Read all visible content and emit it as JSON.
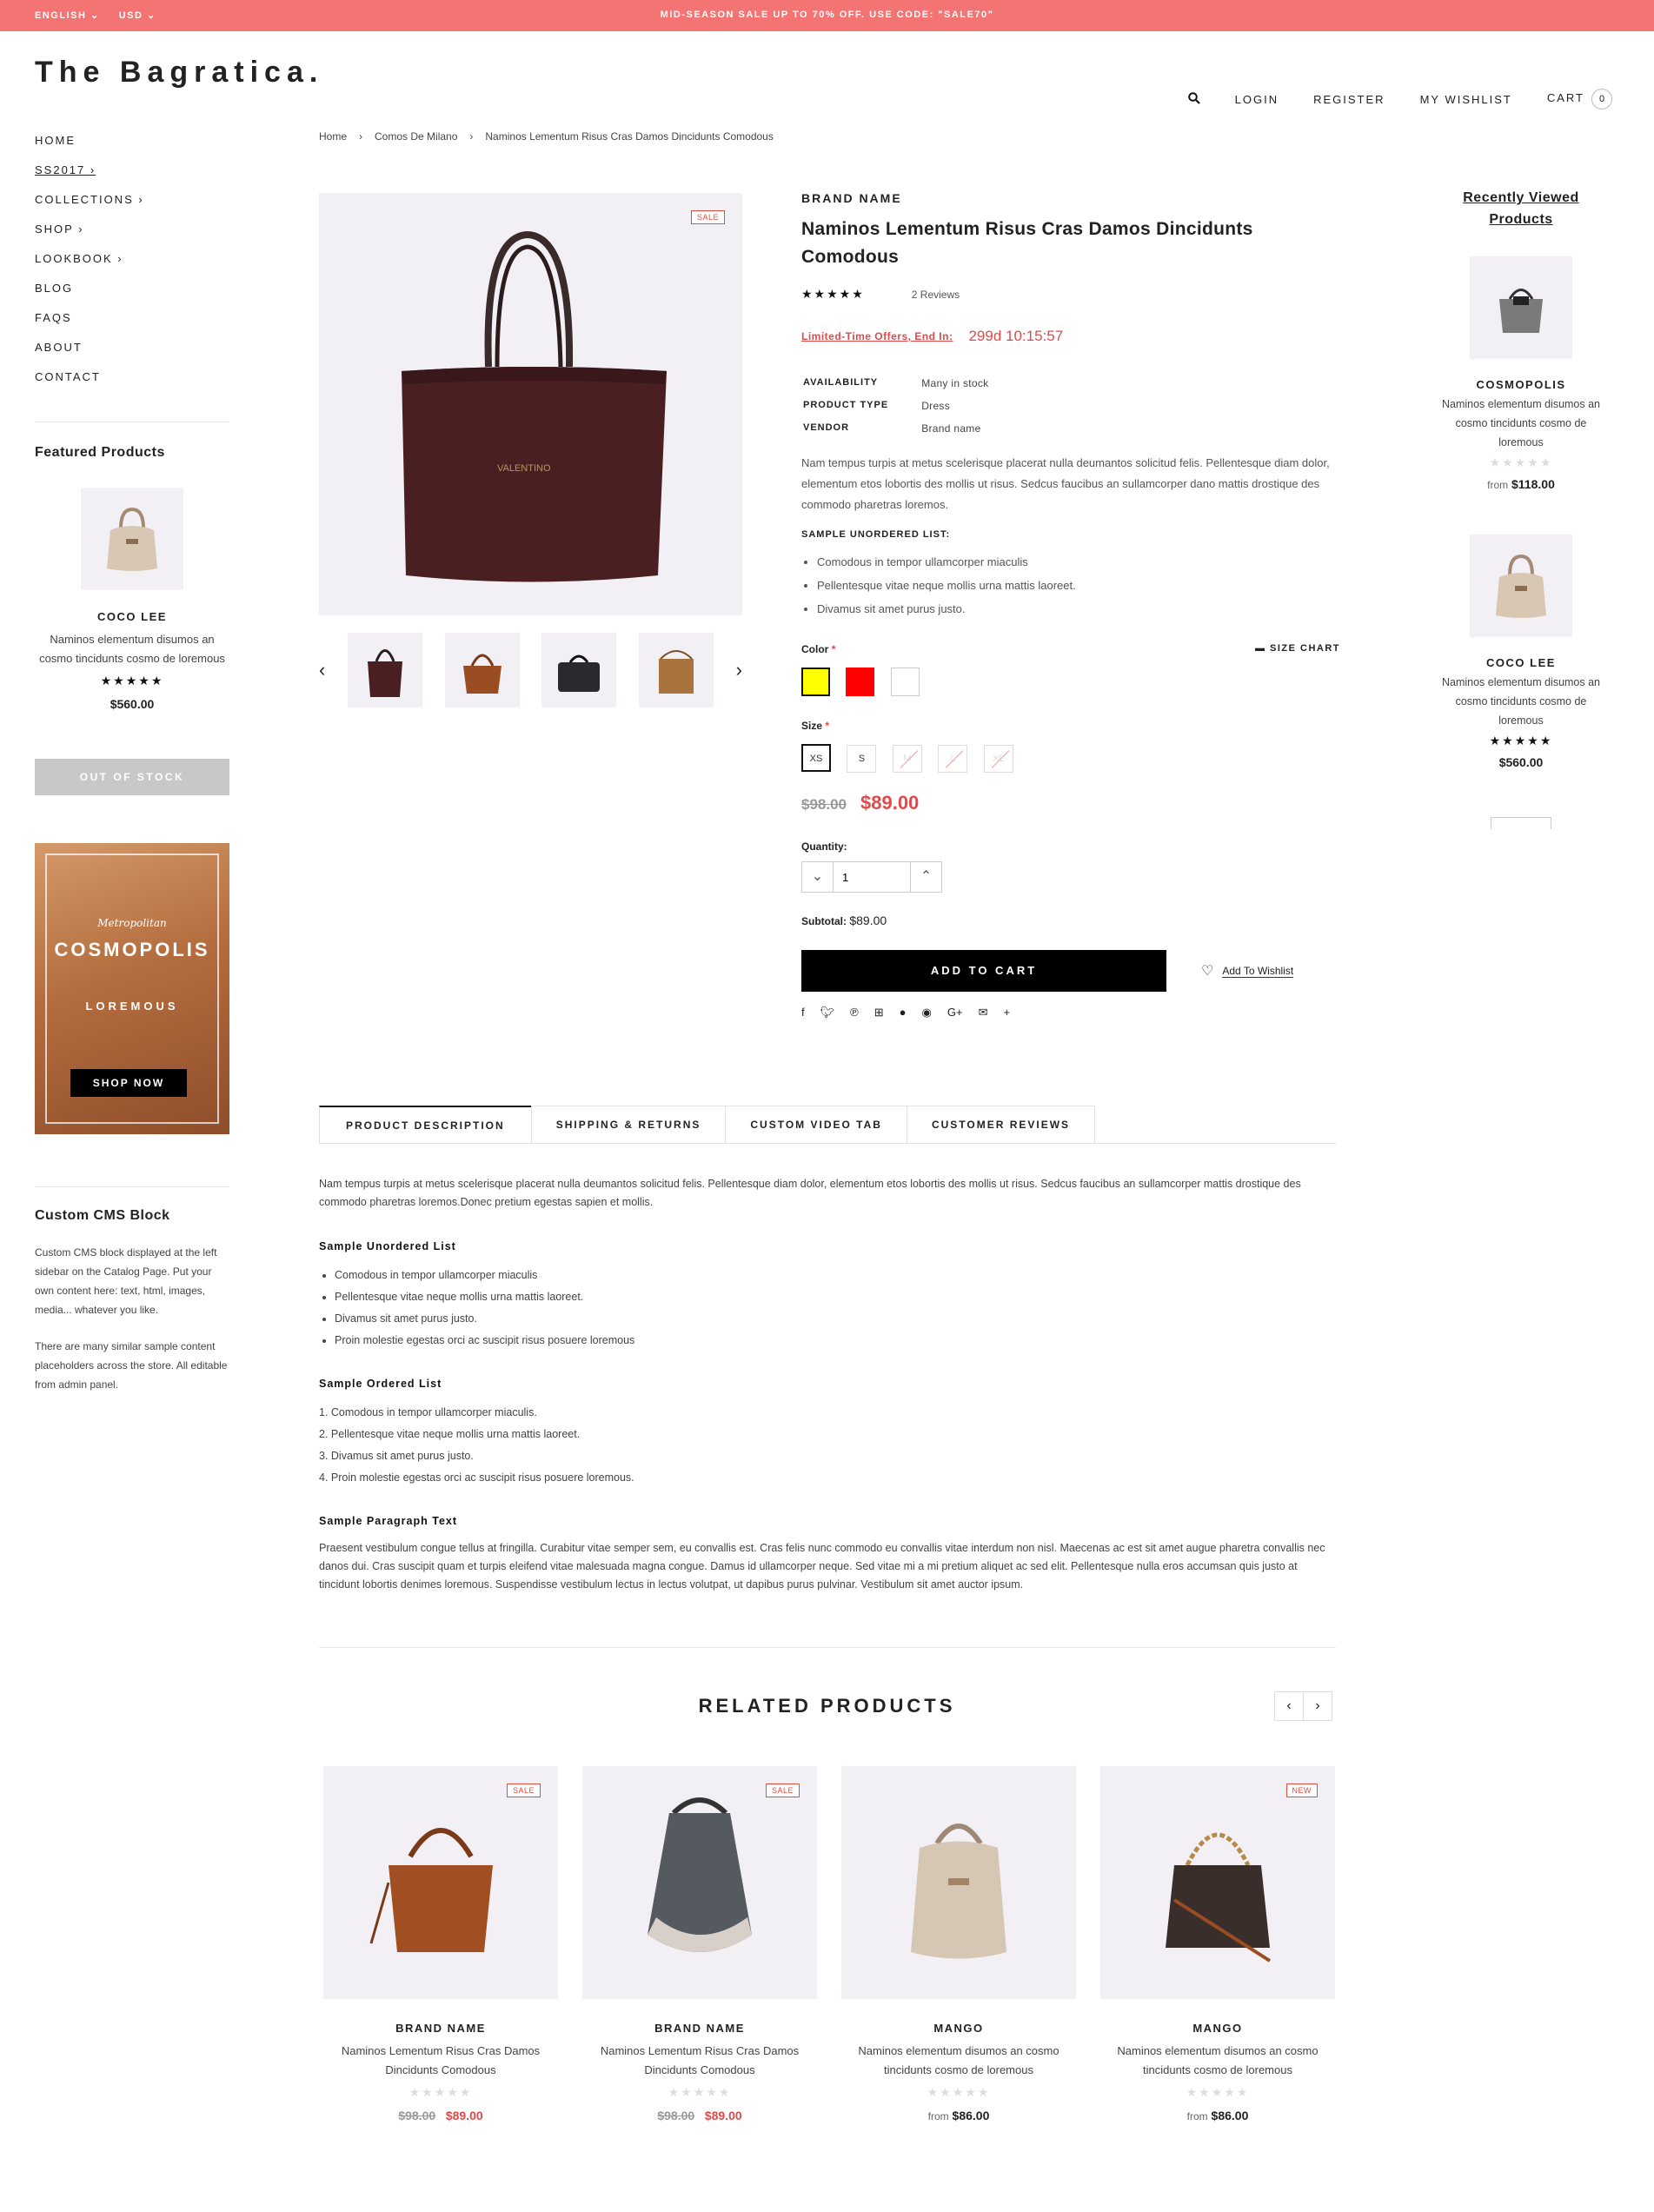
{
  "topbar": {
    "language": "ENGLISH",
    "currency": "USD",
    "promo": "MID-SEASON SALE UP TO 70% OFF. USE CODE: \"SALE70\""
  },
  "header": {
    "logo": "The Bagratica.",
    "login": "LOGIN",
    "register": "REGISTER",
    "wishlist": "MY WISHLIST",
    "cart": "CART",
    "cart_count": "0"
  },
  "sidebar": {
    "nav": [
      "HOME",
      "SS2017 ›",
      "COLLECTIONS ›",
      "SHOP ›",
      "LOOKBOOK ›",
      "BLOG",
      "FAQS",
      "ABOUT",
      "CONTACT"
    ],
    "featured_title": "Featured Products",
    "featured": {
      "brand": "COCO LEE",
      "name": "Naminos elementum disumos an cosmo tincidunts cosmo de loremous",
      "price": "$560.00",
      "button": "OUT OF STOCK"
    },
    "promo": {
      "script": "Metropolitan",
      "title": "COSMOPOLIS",
      "subtitle": "LOREMOUS",
      "button": "SHOP NOW"
    },
    "cms_title": "Custom CMS Block",
    "cms_p1": "Custom CMS block displayed at the left sidebar on the Catalog Page. Put your own content here: text, html, images, media... whatever you like.",
    "cms_p2": "There are many similar sample content placeholders across the store. All editable from admin panel."
  },
  "breadcrumb": {
    "home": "Home",
    "sep": "›",
    "collection": "Comos De Milano",
    "current": "Naminos Lementum Risus Cras Damos Dincidunts Comodous"
  },
  "product": {
    "badge": "SALE",
    "brand": "BRAND NAME",
    "title": "Naminos Lementum Risus Cras Damos Dincidunts Comodous",
    "reviews": "2 Reviews",
    "countdown_label": "Limited-Time Offers, End In:",
    "countdown": "299d 10:15:57",
    "availability_label": "AVAILABILITY",
    "availability": "Many in stock",
    "type_label": "PRODUCT TYPE",
    "type": "Dress",
    "vendor_label": "VENDOR",
    "vendor": "Brand name",
    "description": "Nam tempus turpis at metus scelerisque placerat nulla deumantos solicitud felis. Pellentesque diam dolor, elementum etos lobortis des mollis ut risus. Sedcus faucibus an sullamcorper dano mattis drostique des commodo pharetras loremos.",
    "list_title": "SAMPLE UNORDERED LIST:",
    "list": [
      "Comodous in tempor ullamcorper miaculis",
      "Pellentesque vitae neque mollis urna mattis laoreet.",
      "Divamus sit amet purus justo."
    ],
    "color_label": "Color",
    "size_chart": "SIZE CHART",
    "colors": [
      "#ffff00",
      "#ff0000",
      "#ffffff"
    ],
    "size_label": "Size",
    "sizes": [
      "XS",
      "S",
      "M",
      "L",
      "XL"
    ],
    "old_price": "$98.00",
    "price": "$89.00",
    "quantity_label": "Quantity:",
    "quantity": "1",
    "subtotal_label": "Subtotal:",
    "subtotal": "$89.00",
    "add_to_cart": "ADD TO CART",
    "add_to_wishlist": "Add To Wishlist"
  },
  "recent": {
    "title": "Recently Viewed Products",
    "items": [
      {
        "brand": "COSMOPOLIS",
        "name": "Naminos elementum disumos an cosmo tincidunts cosmo de loremous",
        "from": "from",
        "price": "$118.00"
      },
      {
        "brand": "COCO LEE",
        "name": "Naminos elementum disumos an cosmo tincidunts cosmo de loremous",
        "price": "$560.00"
      }
    ]
  },
  "tabs": [
    "PRODUCT DESCRIPTION",
    "SHIPPING & RETURNS",
    "CUSTOM VIDEO TAB",
    "CUSTOMER REVIEWS"
  ],
  "tab_content": {
    "intro": "Nam tempus turpis at metus scelerisque placerat nulla deumantos solicitud felis. Pellentesque diam dolor, elementum etos lobortis des mollis ut risus. Sedcus faucibus an sullamcorper mattis drostique des commodo pharetras loremos.Donec pretium egestas sapien et mollis.",
    "ul_title": "Sample Unordered List",
    "ul": [
      "Comodous in tempor ullamcorper miaculis",
      "Pellentesque vitae neque mollis urna mattis laoreet.",
      "Divamus sit amet purus justo.",
      "Proin molestie egestas orci ac suscipit risus posuere loremous"
    ],
    "ol_title": "Sample Ordered List",
    "ol": [
      "1. Comodous in tempor ullamcorper miaculis.",
      "2. Pellentesque vitae neque mollis urna mattis laoreet.",
      "3. Divamus sit amet purus justo.",
      "4. Proin molestie egestas orci ac suscipit risus posuere loremous."
    ],
    "p_title": "Sample Paragraph Text",
    "paragraph": "Praesent vestibulum congue tellus at fringilla. Curabitur vitae semper sem, eu convallis est. Cras felis nunc commodo eu convallis vitae interdum non nisl. Maecenas ac est sit amet augue pharetra convallis nec danos dui. Cras suscipit quam et turpis eleifend vitae malesuada magna congue. Damus id ullamcorper neque. Sed vitae mi a mi pretium aliquet ac sed elit. Pellentesque nulla eros accumsan quis justo at tincidunt lobortis denimes loremous. Suspendisse vestibulum lectus in lectus volutpat, ut dapibus purus pulvinar. Vestibulum sit amet auctor ipsum."
  },
  "related": {
    "title": "RELATED PRODUCTS",
    "items": [
      {
        "badge": "SALE",
        "brand": "BRAND NAME",
        "name": "Naminos Lementum Risus Cras Damos Dincidunts Comodous",
        "old": "$98.00",
        "price": "$89.00"
      },
      {
        "badge": "SALE",
        "brand": "BRAND NAME",
        "name": "Naminos Lementum Risus Cras Damos Dincidunts Comodous",
        "old": "$98.00",
        "price": "$89.00"
      },
      {
        "badge": "",
        "brand": "MANGO",
        "name": "Naminos elementum disumos an cosmo tincidunts cosmo de loremous",
        "from": "from",
        "price": "$86.00"
      },
      {
        "badge": "NEW",
        "brand": "MANGO",
        "name": "Naminos elementum disumos an cosmo tincidunts cosmo de loremous",
        "from": "from",
        "price": "$86.00"
      }
    ]
  }
}
